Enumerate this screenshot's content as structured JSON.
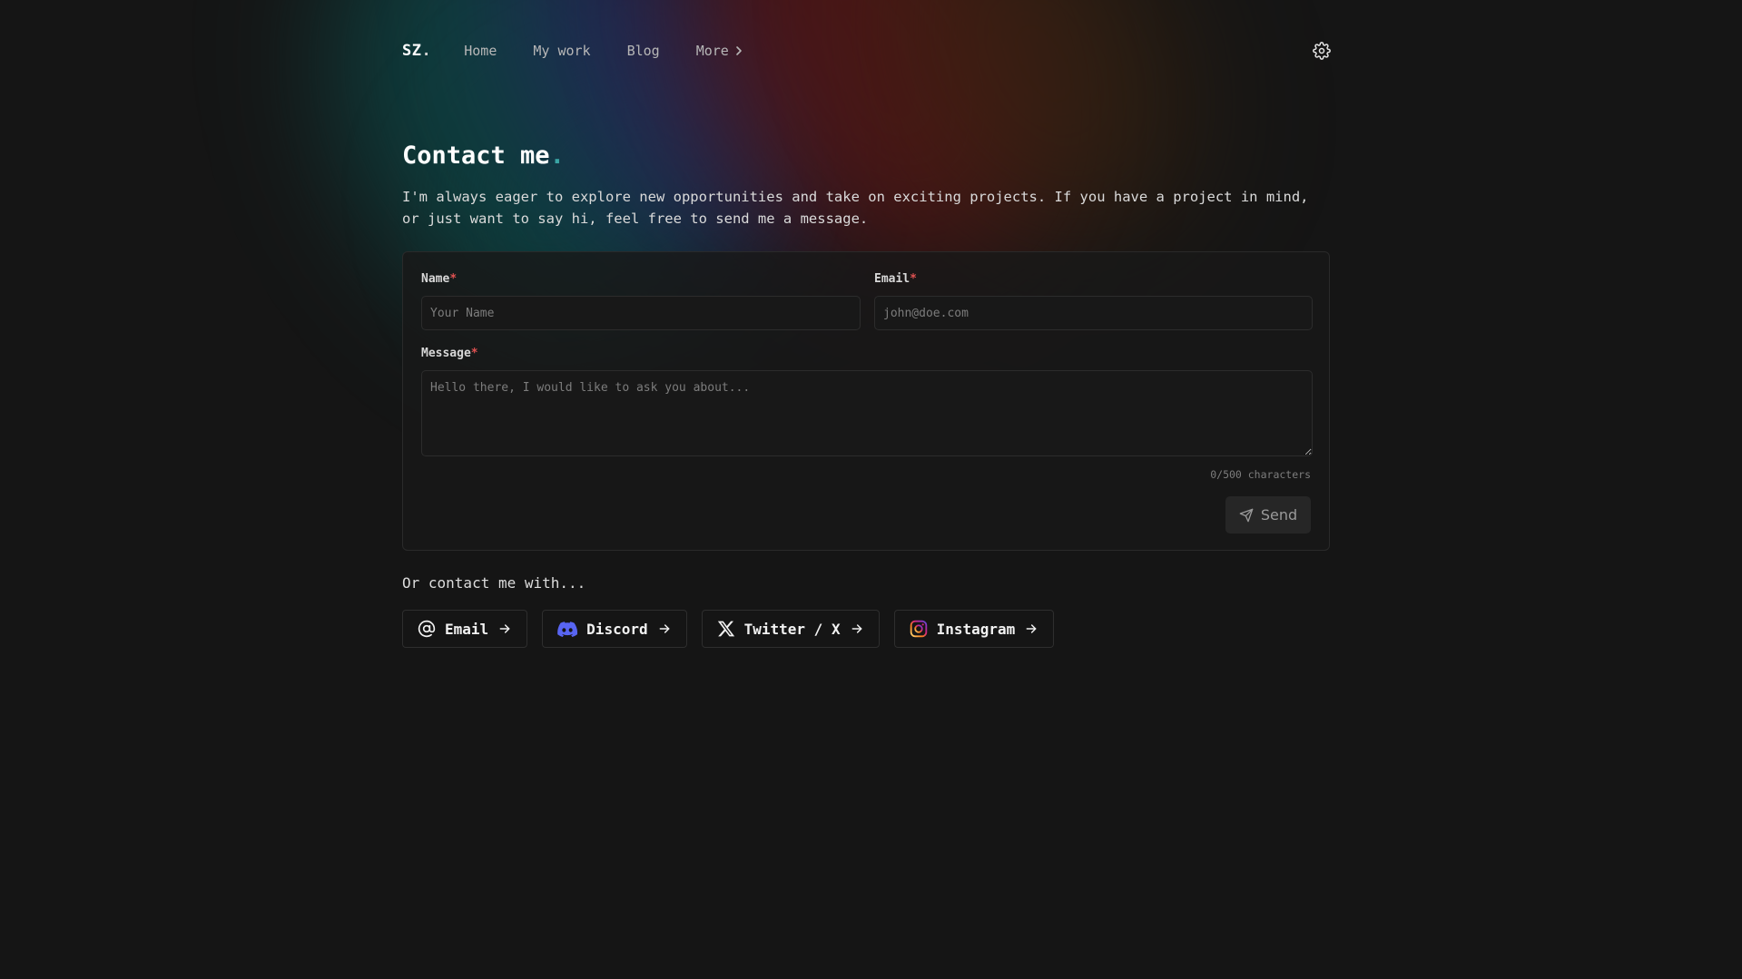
{
  "nav": {
    "logo": "SZ",
    "logo_dot": ".",
    "links": [
      {
        "label": "Home"
      },
      {
        "label": "My work"
      },
      {
        "label": "Blog"
      },
      {
        "label": "More"
      }
    ],
    "settings_icon": "gear-icon"
  },
  "hero": {
    "title": "Contact me",
    "title_dot": ".",
    "intro": "I'm always eager to explore new opportunities and take on exciting projects. If you have a project in mind, or just want to say hi, feel free to send me a message."
  },
  "form": {
    "name": {
      "label": "Name",
      "required": "*",
      "placeholder": "Your Name",
      "value": ""
    },
    "email": {
      "label": "Email",
      "required": "*",
      "placeholder": "john@doe.com",
      "value": ""
    },
    "message": {
      "label": "Message",
      "required": "*",
      "placeholder": "Hello there, I would like to ask you about...",
      "value": ""
    },
    "counter": "0/500 characters",
    "send_label": "Send"
  },
  "contact": {
    "heading": "Or contact me with...",
    "buttons": [
      {
        "label": "Email",
        "icon": "at-sign-icon"
      },
      {
        "label": "Discord",
        "icon": "discord-icon"
      },
      {
        "label": "Twitter / X",
        "icon": "x-logo-icon"
      },
      {
        "label": "Instagram",
        "icon": "instagram-icon"
      }
    ]
  },
  "colors": {
    "background": "#151515",
    "accent_dot": "#3aa5a5",
    "required": "#e05252",
    "discord": "#5865f2"
  }
}
